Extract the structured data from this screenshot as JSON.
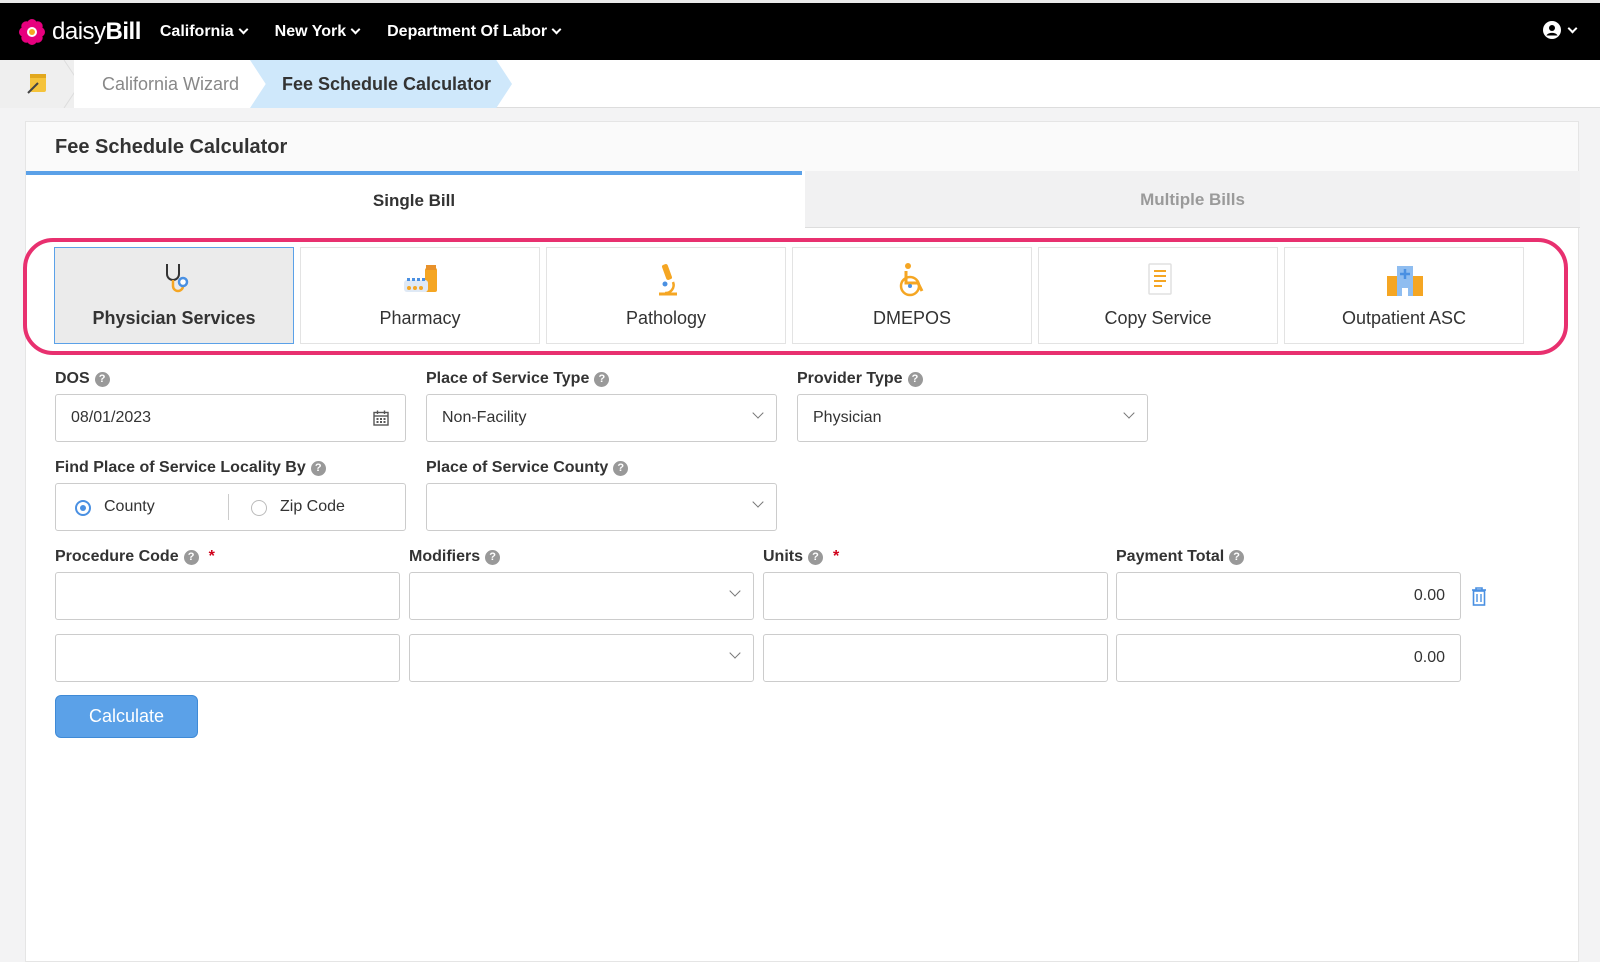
{
  "topnav": {
    "logo_light": "daisy",
    "logo_bold": "Bill",
    "menu": [
      "California",
      "New York",
      "Department Of Labor"
    ],
    "user_icon": "user-circle-icon"
  },
  "breadcrumb": {
    "home_icon": "notepad-icon",
    "items": [
      "California Wizard",
      "Fee Schedule Calculator"
    ]
  },
  "card": {
    "title": "Fee Schedule Calculator",
    "tabs": [
      "Single Bill",
      "Multiple Bills"
    ],
    "active_tab": "Single Bill"
  },
  "services": [
    {
      "label": "Physician Services",
      "icon": "stethoscope-icon",
      "active": true
    },
    {
      "label": "Pharmacy",
      "icon": "pills-icon",
      "active": false
    },
    {
      "label": "Pathology",
      "icon": "microscope-icon",
      "active": false
    },
    {
      "label": "DMEPOS",
      "icon": "wheelchair-icon",
      "active": false
    },
    {
      "label": "Copy Service",
      "icon": "document-icon",
      "active": false
    },
    {
      "label": "Outpatient ASC",
      "icon": "hospital-icon",
      "active": false
    }
  ],
  "form": {
    "dos": {
      "label": "DOS",
      "value": "08/01/2023"
    },
    "pos_type": {
      "label": "Place of Service Type",
      "value": "Non-Facility"
    },
    "provider_type": {
      "label": "Provider Type",
      "value": "Physician"
    },
    "locality_by": {
      "label": "Find Place of Service Locality By",
      "options": [
        "County",
        "Zip Code"
      ],
      "selected": "County"
    },
    "pos_county": {
      "label": "Place of Service County",
      "value": ""
    },
    "columns": {
      "procedure": "Procedure Code",
      "modifiers": "Modifiers",
      "units": "Units",
      "payment": "Payment Total"
    },
    "required_mark": "*",
    "rows": [
      {
        "procedure": "",
        "modifiers": "",
        "units": "",
        "payment": "0.00"
      },
      {
        "procedure": "",
        "modifiers": "",
        "units": "",
        "payment": "0.00"
      }
    ],
    "calculate_label": "Calculate"
  },
  "colors": {
    "accent": "#5ba1e8",
    "highlight": "#e8306f",
    "required": "#d0021b"
  }
}
